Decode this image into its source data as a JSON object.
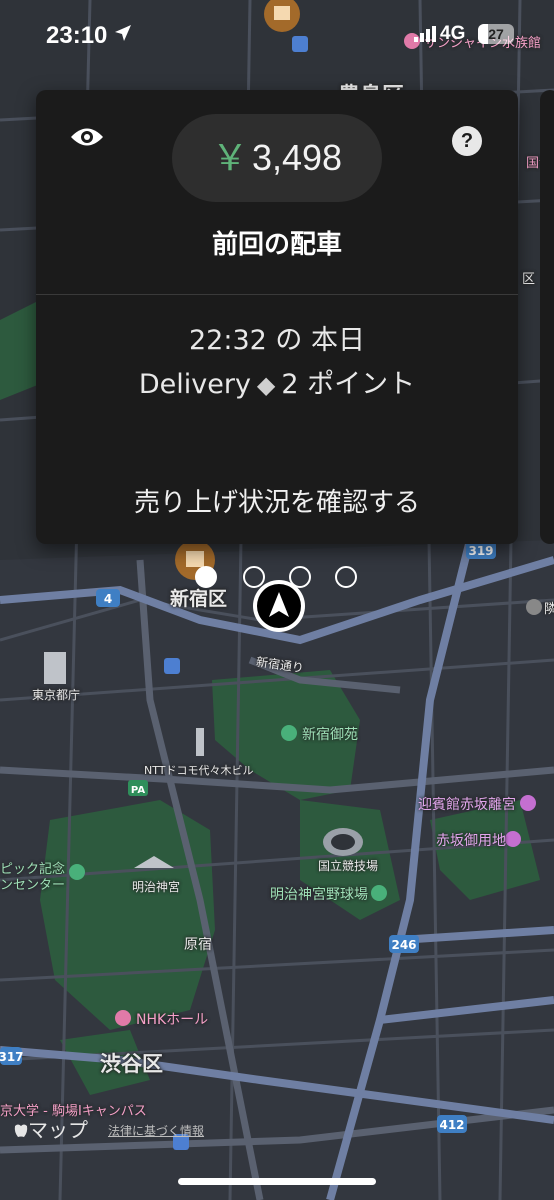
{
  "status_bar": {
    "time": "23:10",
    "network": "4G",
    "battery": "27",
    "battery_level": 0.27,
    "icons": [
      "location-arrow-icon",
      "signal-icon"
    ]
  },
  "earnings_card": {
    "currency_symbol": "￥",
    "amount": "3,498",
    "title": "前回の配車",
    "trip_time_line": "22:32 の 本日",
    "service": "Delivery",
    "points": "2 ポイント",
    "points_icon": "diamond-icon",
    "link": "売り上げ状況を確認する",
    "icons": [
      "eye-icon",
      "help-icon"
    ],
    "colors": {
      "card": "#1b1b1b",
      "pill": "#2e2e2e",
      "currency": "#5fb379"
    }
  },
  "pager": {
    "count": 4,
    "active_index": 0
  },
  "map": {
    "labels": [
      "豊島区",
      "サンシャイン水族館",
      "新宿区",
      "新宿通り",
      "東京都庁",
      "新宿御苑",
      "NTTドコモ代々木ビル",
      "迎賓館赤坂離宮",
      "赤坂御用地",
      "国立競技場",
      "明治神宮野球場",
      "明治神宮",
      "ピック記念",
      "ンセンター",
      "原宿",
      "NHKホール",
      "渋谷区",
      "京大学 - 駒場Iキャンパス"
    ],
    "route_shields": [
      "319",
      "4",
      "246",
      "317",
      "412",
      "PA"
    ],
    "partial_labels": [
      "国寺",
      "区",
      "隣"
    ],
    "colors": {
      "land": "#2f3339",
      "park": "#2d5a3e",
      "road": "#5a6170",
      "highway": "#6f7fa3"
    }
  },
  "footer": {
    "maps_credit": "マップ",
    "legal": "法律に基づく情報"
  }
}
